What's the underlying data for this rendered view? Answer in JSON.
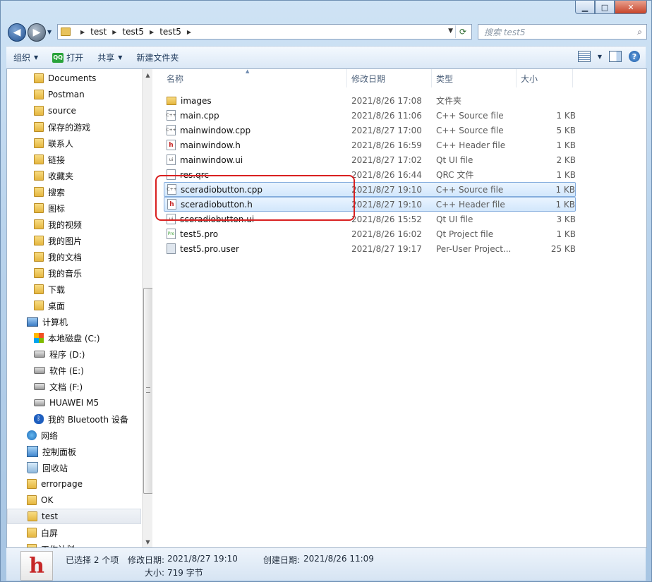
{
  "window": {
    "controls": {
      "minimize": "▁",
      "maximize": "□",
      "close": "✕"
    }
  },
  "address": {
    "crumbs": [
      "test",
      "test5",
      "test5"
    ],
    "search_placeholder": "搜索 test5"
  },
  "toolbar": {
    "organize": "组织",
    "open": "打开",
    "open_badge": "QQ",
    "share": "共享",
    "new_folder": "新建文件夹"
  },
  "nav": {
    "items": [
      {
        "label": "Documents",
        "icon": "folder"
      },
      {
        "label": "Postman",
        "icon": "folder"
      },
      {
        "label": "source",
        "icon": "folder"
      },
      {
        "label": "保存的游戏",
        "icon": "folder"
      },
      {
        "label": "联系人",
        "icon": "folder"
      },
      {
        "label": "链接",
        "icon": "folder"
      },
      {
        "label": "收藏夹",
        "icon": "folder"
      },
      {
        "label": "搜索",
        "icon": "folder"
      },
      {
        "label": "图标",
        "icon": "folder"
      },
      {
        "label": "我的视频",
        "icon": "folder"
      },
      {
        "label": "我的图片",
        "icon": "folder"
      },
      {
        "label": "我的文档",
        "icon": "folder"
      },
      {
        "label": "我的音乐",
        "icon": "folder"
      },
      {
        "label": "下载",
        "icon": "folder"
      },
      {
        "label": "桌面",
        "icon": "folder"
      },
      {
        "label": "计算机",
        "icon": "computer"
      },
      {
        "label": "本地磁盘 (C:)",
        "icon": "windows"
      },
      {
        "label": "程序 (D:)",
        "icon": "drive"
      },
      {
        "label": "软件 (E:)",
        "icon": "drive"
      },
      {
        "label": "文档 (F:)",
        "icon": "drive"
      },
      {
        "label": "HUAWEI M5",
        "icon": "drive"
      },
      {
        "label": "我的 Bluetooth 设备",
        "icon": "bluetooth"
      },
      {
        "label": "网络",
        "icon": "network"
      },
      {
        "label": "控制面板",
        "icon": "control"
      },
      {
        "label": "回收站",
        "icon": "recycle"
      },
      {
        "label": "errorpage",
        "icon": "folder"
      },
      {
        "label": "OK",
        "icon": "folder"
      },
      {
        "label": "test",
        "icon": "folder",
        "selected": true
      },
      {
        "label": "白屏",
        "icon": "folder"
      },
      {
        "label": "工作计划",
        "icon": "folder"
      }
    ]
  },
  "columns": {
    "name": "名称",
    "date": "修改日期",
    "type": "类型",
    "size": "大小"
  },
  "files": [
    {
      "name": "images",
      "date": "2021/8/26 17:08",
      "type": "文件夹",
      "size": "",
      "icon": "folder"
    },
    {
      "name": "main.cpp",
      "date": "2021/8/26 11:06",
      "type": "C++ Source file",
      "size": "1 KB",
      "icon": "cpp"
    },
    {
      "name": "mainwindow.cpp",
      "date": "2021/8/27 17:00",
      "type": "C++ Source file",
      "size": "5 KB",
      "icon": "cpp"
    },
    {
      "name": "mainwindow.h",
      "date": "2021/8/26 16:59",
      "type": "C++ Header file",
      "size": "1 KB",
      "icon": "h"
    },
    {
      "name": "mainwindow.ui",
      "date": "2021/8/27 17:02",
      "type": "Qt UI file",
      "size": "2 KB",
      "icon": "ui"
    },
    {
      "name": "res.qrc",
      "date": "2021/8/26 16:44",
      "type": "QRC 文件",
      "size": "1 KB",
      "icon": "blank"
    },
    {
      "name": "sceradiobutton.cpp",
      "date": "2021/8/27 19:10",
      "type": "C++ Source file",
      "size": "1 KB",
      "icon": "cpp",
      "selected": true
    },
    {
      "name": "sceradiobutton.h",
      "date": "2021/8/27 19:10",
      "type": "C++ Header file",
      "size": "1 KB",
      "icon": "h",
      "selected": true
    },
    {
      "name": "sceradiobutton.ui",
      "date": "2021/8/26 15:52",
      "type": "Qt UI file",
      "size": "3 KB",
      "icon": "ui"
    },
    {
      "name": "test5.pro",
      "date": "2021/8/26 16:02",
      "type": "Qt Project file",
      "size": "1 KB",
      "icon": "pro"
    },
    {
      "name": "test5.pro.user",
      "date": "2021/8/27 19:17",
      "type": "Per-User Project...",
      "size": "25 KB",
      "icon": "user"
    }
  ],
  "status": {
    "thumb_letter": "h",
    "selected_count": "已选择 2 个项",
    "modified_label": "修改日期:",
    "modified_value": "2021/8/27 19:10",
    "created_label": "创建日期:",
    "created_value": "2021/8/26 11:09",
    "size_label": "大小:",
    "size_value": "719 字节"
  }
}
